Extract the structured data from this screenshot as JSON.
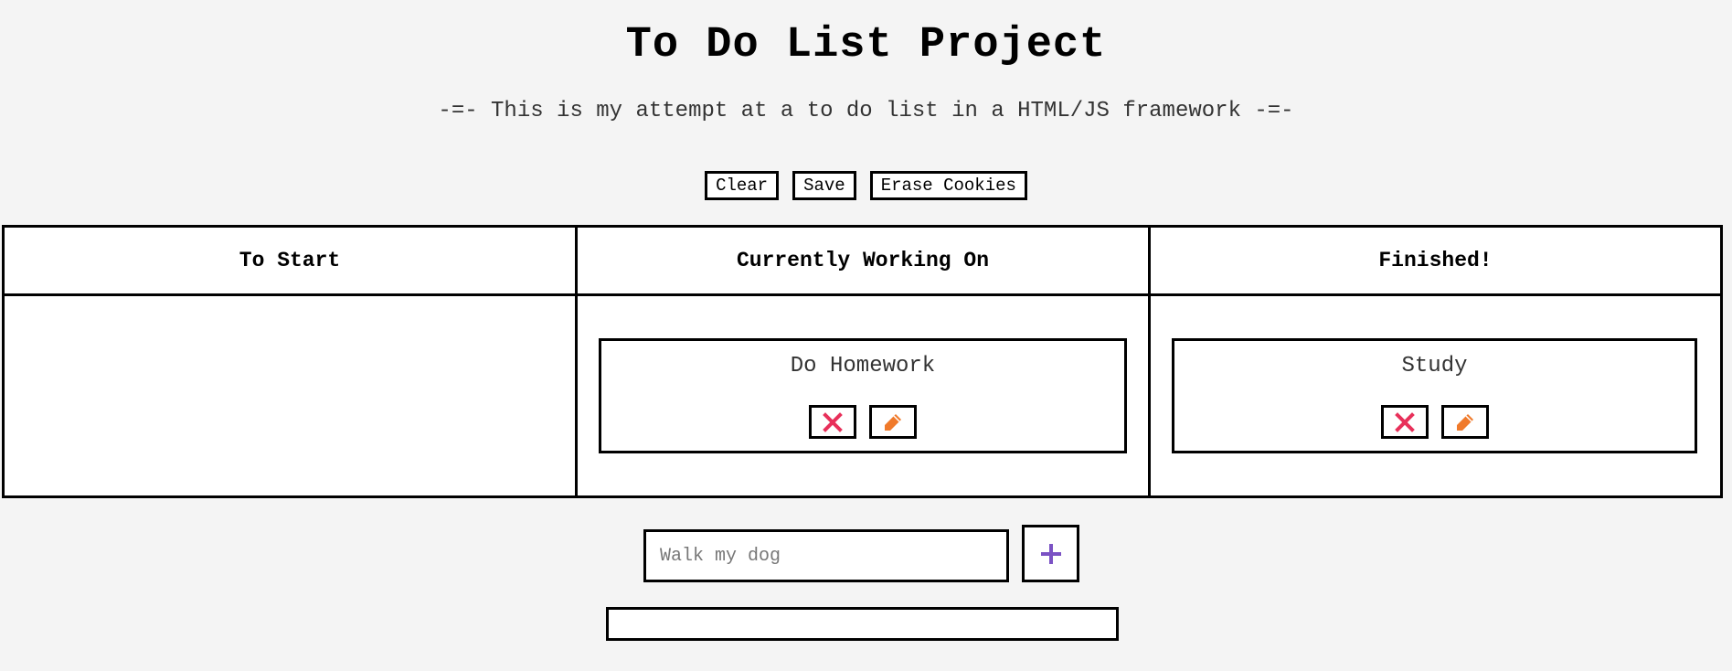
{
  "header": {
    "title": "To Do List Project",
    "subtitle": "-=- This is my attempt at a to do list in a HTML/JS framework -=-"
  },
  "toolbar": {
    "clear_label": "Clear",
    "save_label": "Save",
    "erase_label": "Erase Cookies"
  },
  "board": {
    "columns": [
      {
        "title": "To Start",
        "tasks": []
      },
      {
        "title": "Currently Working On",
        "tasks": [
          {
            "name": "Do Homework"
          }
        ]
      },
      {
        "title": "Finished!",
        "tasks": [
          {
            "name": "Study"
          }
        ]
      }
    ]
  },
  "new_task": {
    "placeholder": "Walk my dog",
    "value": "",
    "add_icon": "plus-icon"
  },
  "icons": {
    "delete": "close-icon",
    "edit": "pencil-icon"
  },
  "colors": {
    "delete_icon": "#e8305a",
    "edit_icon": "#f07a2b",
    "add_icon": "#7b52c4",
    "background": "#f4f4f4"
  }
}
